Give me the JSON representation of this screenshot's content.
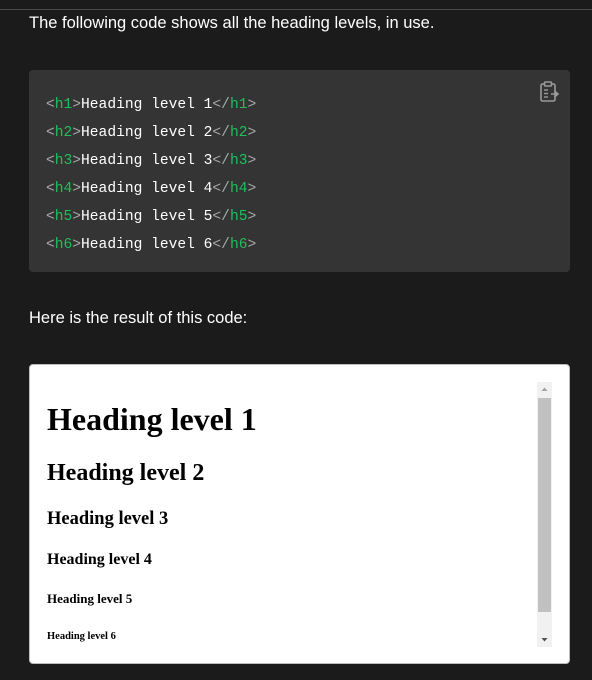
{
  "intro_text": "The following code shows all the heading levels, in use.",
  "result_text": "Here is the result of this code:",
  "code_block": {
    "copy_icon": "clipboard-copy-icon",
    "lines": [
      {
        "open": "h1",
        "text": "Heading level 1",
        "close": "h1"
      },
      {
        "open": "h2",
        "text": "Heading level 2",
        "close": "h2"
      },
      {
        "open": "h3",
        "text": "Heading level 3",
        "close": "h3"
      },
      {
        "open": "h4",
        "text": "Heading level 4",
        "close": "h4"
      },
      {
        "open": "h5",
        "text": "Heading level 5",
        "close": "h5"
      },
      {
        "open": "h6",
        "text": "Heading level 6",
        "close": "h6"
      }
    ]
  },
  "result": {
    "headings": [
      "Heading level 1",
      "Heading level 2",
      "Heading level 3",
      "Heading level 4",
      "Heading level 5",
      "Heading level 6"
    ]
  },
  "colors": {
    "page_background": "#1b1b1b",
    "code_background": "#343434",
    "tag_name": "#1fbf5c",
    "angle_brackets": "#a8a8a8",
    "code_text": "#ffffff"
  }
}
